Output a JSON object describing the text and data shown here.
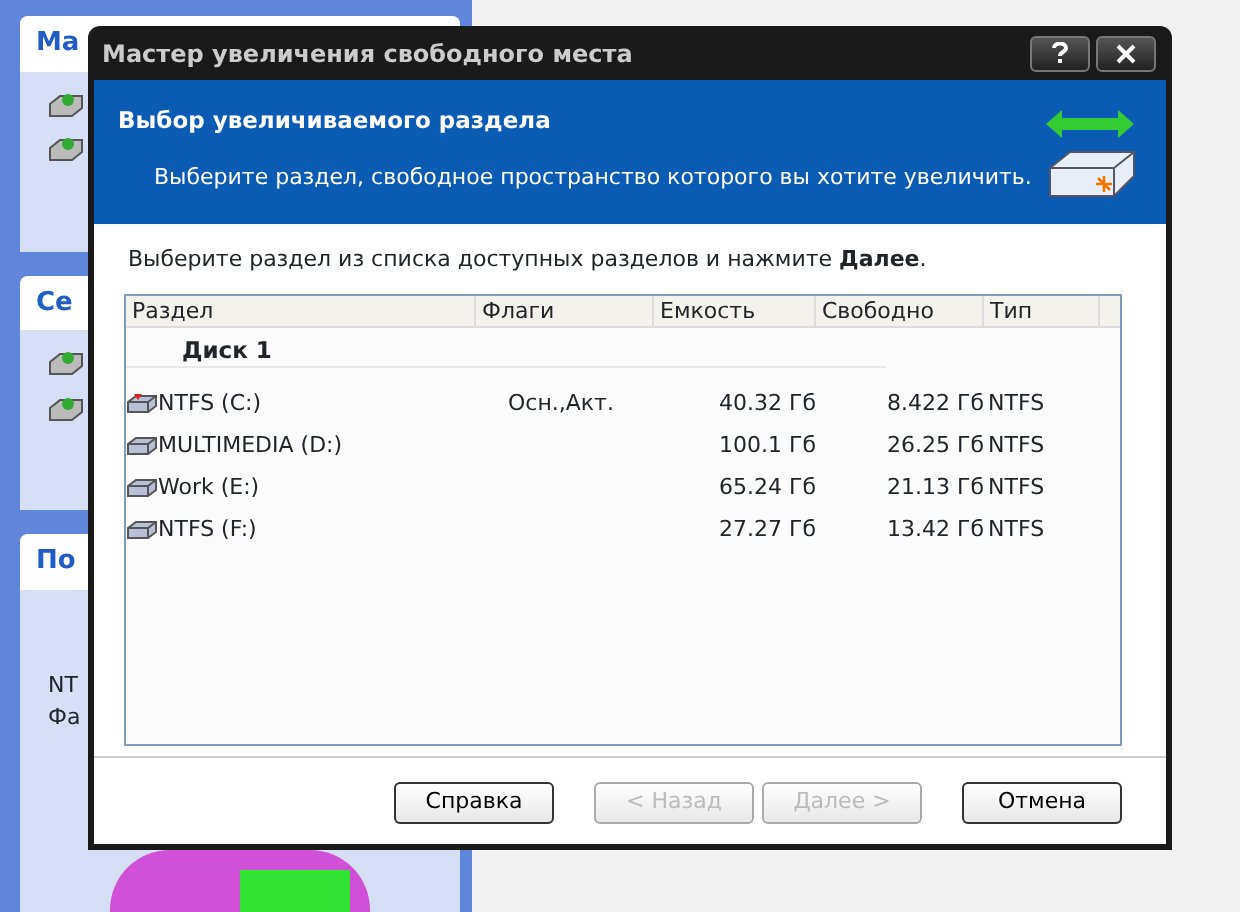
{
  "background_app": {
    "side_panels": [
      {
        "heading": "Ма"
      },
      {
        "heading": "Се"
      },
      {
        "heading": "По",
        "lines": [
          "NT",
          "Фа"
        ]
      }
    ]
  },
  "dialog": {
    "title": "Мастер увеличения свободного места",
    "header": {
      "title": "Выбор увеличиваемого раздела",
      "subtitle": "Выберите раздел, свободное пространство которого вы хотите увеличить."
    },
    "instruction": "Выберите раздел из списка доступных разделов и нажмите **Далее**.",
    "table": {
      "columns": [
        "Раздел",
        "Флаги",
        "Емкость",
        "Свободно",
        "Тип"
      ],
      "groups": [
        {
          "label": "Диск 1",
          "rows": [
            {
              "cells": [
                "NTFS (C:)",
                "Осн.,Акт.",
                "40.32 Гб",
                "8.422 Гб",
                "NTFS"
              ],
              "system": true
            },
            {
              "cells": [
                "MULTIMEDIA (D:)",
                "",
                "100.1 Гб",
                "26.25 Гб",
                "NTFS"
              ],
              "system": false
            },
            {
              "cells": [
                "Work (E:)",
                "",
                "65.24 Гб",
                "21.13 Гб",
                "NTFS"
              ],
              "system": false
            },
            {
              "cells": [
                "NTFS (F:)",
                "",
                "27.27 Гб",
                "13.42 Гб",
                "NTFS"
              ],
              "system": false
            }
          ]
        }
      ]
    },
    "buttons": [
      {
        "label": "Справка",
        "disabled": false
      },
      {
        "label": "< Назад",
        "disabled": true
      },
      {
        "label": "Далее >",
        "disabled": true
      },
      {
        "label": "Отмена",
        "disabled": false
      }
    ]
  }
}
